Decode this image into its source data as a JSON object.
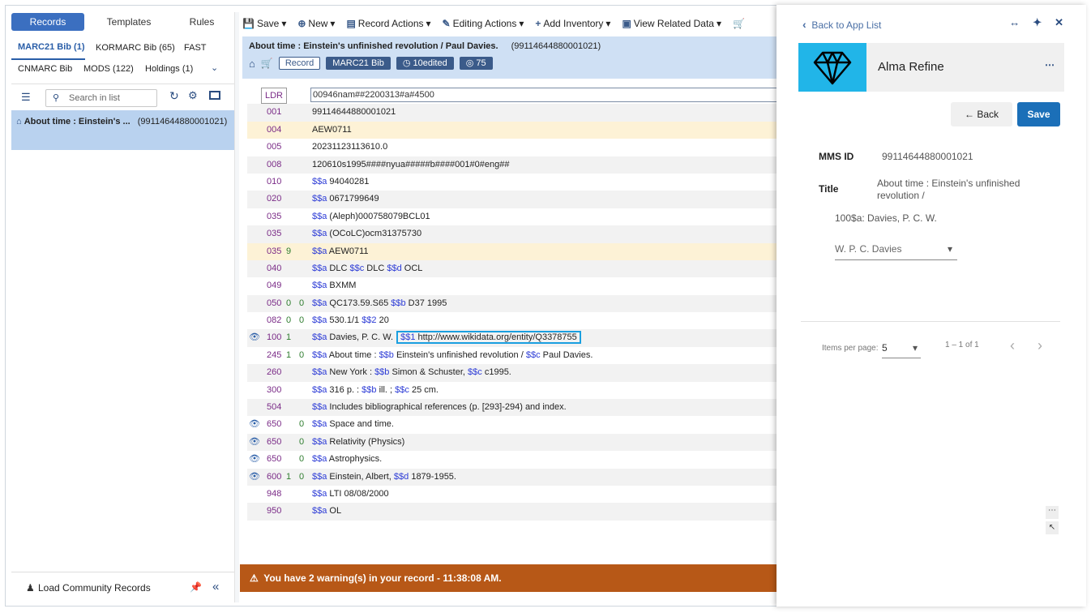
{
  "left": {
    "tabs": [
      "Records",
      "Templates",
      "Rules"
    ],
    "formats_row1": [
      {
        "label": "MARC21 Bib (1)",
        "active": true
      },
      {
        "label": "KORMARC Bib (65)",
        "active": false
      },
      {
        "label": "FAST",
        "active": false
      }
    ],
    "formats_row2": [
      {
        "label": "CNMARC Bib",
        "active": false
      },
      {
        "label": "MODS (122)",
        "active": false
      },
      {
        "label": "Holdings (1)",
        "active": false
      }
    ],
    "search_placeholder": "Search in list",
    "record": {
      "title": "About time : Einstein's ...",
      "id": "(99114644880001021)"
    },
    "load_community": "Load Community Records"
  },
  "toolbar": {
    "save": "Save",
    "new": "New",
    "record_actions": "Record Actions",
    "editing_actions": "Editing Actions",
    "add_inventory": "Add Inventory",
    "view_related": "View Related Data"
  },
  "record_header": {
    "title": "About time : Einstein's unfinished revolution / Paul Davies.",
    "id": "(99114644880001021)",
    "badges": [
      "Record",
      "MARC21 Bib",
      "10edited",
      "75"
    ]
  },
  "marc": {
    "ldr_label": "LDR",
    "ldr_value": "00946nam##2200313#a#4500",
    "fields": [
      {
        "tag": "001",
        "i1": "",
        "i2": "",
        "parts": [
          [
            "t",
            "99114644880001021"
          ]
        ],
        "bg": "alt"
      },
      {
        "tag": "004",
        "i1": "",
        "i2": "",
        "parts": [
          [
            "t",
            "AEW0711"
          ]
        ],
        "bg": "warn"
      },
      {
        "tag": "005",
        "i1": "",
        "i2": "",
        "parts": [
          [
            "t",
            "20231123113610.0"
          ]
        ],
        "bg": ""
      },
      {
        "tag": "008",
        "i1": "",
        "i2": "",
        "parts": [
          [
            "t",
            "120610s1995####nyua#####b####001#0#eng##"
          ]
        ],
        "bg": "alt"
      },
      {
        "tag": "010",
        "i1": "",
        "i2": "",
        "parts": [
          [
            "s",
            "$$a"
          ],
          [
            "t",
            " 94040281"
          ]
        ],
        "bg": ""
      },
      {
        "tag": "020",
        "i1": "",
        "i2": "",
        "parts": [
          [
            "s",
            "$$a"
          ],
          [
            "t",
            " 0671799649"
          ]
        ],
        "bg": "alt"
      },
      {
        "tag": "035",
        "i1": "",
        "i2": "",
        "parts": [
          [
            "s",
            "$$a"
          ],
          [
            "t",
            " (Aleph)000758079BCL01"
          ]
        ],
        "bg": ""
      },
      {
        "tag": "035",
        "i1": "",
        "i2": "",
        "parts": [
          [
            "s",
            "$$a"
          ],
          [
            "t",
            " (OCoLC)ocm31375730"
          ]
        ],
        "bg": "alt"
      },
      {
        "tag": "035",
        "i1": "9",
        "i2": "",
        "parts": [
          [
            "s",
            "$$a"
          ],
          [
            "t",
            " AEW0711"
          ]
        ],
        "bg": "warn"
      },
      {
        "tag": "040",
        "i1": "",
        "i2": "",
        "parts": [
          [
            "s",
            "$$a"
          ],
          [
            "t",
            " DLC "
          ],
          [
            "s",
            "$$c"
          ],
          [
            "t",
            " DLC "
          ],
          [
            "s",
            "$$d"
          ],
          [
            "t",
            " OCL"
          ]
        ],
        "bg": "alt"
      },
      {
        "tag": "049",
        "i1": "",
        "i2": "",
        "parts": [
          [
            "s",
            "$$a"
          ],
          [
            "t",
            " BXMM"
          ]
        ],
        "bg": ""
      },
      {
        "tag": "050",
        "i1": "0",
        "i2": "0",
        "parts": [
          [
            "s",
            "$$a"
          ],
          [
            "t",
            " QC173.59.S65 "
          ],
          [
            "s",
            "$$b"
          ],
          [
            "t",
            " D37 1995"
          ]
        ],
        "bg": "alt"
      },
      {
        "tag": "082",
        "i1": "0",
        "i2": "0",
        "parts": [
          [
            "s",
            "$$a"
          ],
          [
            "t",
            " 530.1/1 "
          ],
          [
            "s",
            "$$2"
          ],
          [
            "t",
            " 20"
          ]
        ],
        "bg": ""
      },
      {
        "tag": "100",
        "i1": "1",
        "i2": "",
        "binoc": true,
        "parts": [
          [
            "s",
            "$$a"
          ],
          [
            "t",
            " Davies, P. C. W."
          ]
        ],
        "hl": [
          [
            "s",
            "$$1"
          ],
          [
            "t",
            " http://www.wikidata.org/entity/Q3378755"
          ]
        ],
        "bg": "alt"
      },
      {
        "tag": "245",
        "i1": "1",
        "i2": "0",
        "parts": [
          [
            "s",
            "$$a"
          ],
          [
            "t",
            " About time : "
          ],
          [
            "s",
            "$$b"
          ],
          [
            "t",
            " Einstein's unfinished revolution / "
          ],
          [
            "s",
            "$$c"
          ],
          [
            "t",
            " Paul Davies."
          ]
        ],
        "bg": ""
      },
      {
        "tag": "260",
        "i1": "",
        "i2": "",
        "parts": [
          [
            "s",
            "$$a"
          ],
          [
            "t",
            " New York : "
          ],
          [
            "s",
            "$$b"
          ],
          [
            "t",
            " Simon & Schuster, "
          ],
          [
            "s",
            "$$c"
          ],
          [
            "t",
            " c1995."
          ]
        ],
        "bg": "alt"
      },
      {
        "tag": "300",
        "i1": "",
        "i2": "",
        "parts": [
          [
            "s",
            "$$a"
          ],
          [
            "t",
            " 316 p. : "
          ],
          [
            "s",
            "$$b"
          ],
          [
            "t",
            " ill. ; "
          ],
          [
            "s",
            "$$c"
          ],
          [
            "t",
            " 25 cm."
          ]
        ],
        "bg": ""
      },
      {
        "tag": "504",
        "i1": "",
        "i2": "",
        "parts": [
          [
            "s",
            "$$a"
          ],
          [
            "t",
            " Includes bibliographical references (p. [293]-294) and index."
          ]
        ],
        "bg": "alt"
      },
      {
        "tag": "650",
        "i1": "",
        "i2": "0",
        "binoc": true,
        "parts": [
          [
            "s",
            "$$a"
          ],
          [
            "t",
            " Space and time."
          ]
        ],
        "bg": ""
      },
      {
        "tag": "650",
        "i1": "",
        "i2": "0",
        "binoc": true,
        "parts": [
          [
            "s",
            "$$a"
          ],
          [
            "t",
            " Relativity (Physics)"
          ]
        ],
        "bg": "alt"
      },
      {
        "tag": "650",
        "i1": "",
        "i2": "0",
        "binoc": true,
        "parts": [
          [
            "s",
            "$$a"
          ],
          [
            "t",
            " Astrophysics."
          ]
        ],
        "bg": ""
      },
      {
        "tag": "600",
        "i1": "1",
        "i2": "0",
        "binoc": true,
        "parts": [
          [
            "s",
            "$$a"
          ],
          [
            "t",
            " Einstein, Albert, "
          ],
          [
            "s",
            "$$d"
          ],
          [
            "t",
            " 1879-1955."
          ]
        ],
        "bg": "alt"
      },
      {
        "tag": "948",
        "i1": "",
        "i2": "",
        "parts": [
          [
            "s",
            "$$a"
          ],
          [
            "t",
            " LTI 08/08/2000"
          ]
        ],
        "bg": ""
      },
      {
        "tag": "950",
        "i1": "",
        "i2": "",
        "parts": [
          [
            "s",
            "$$a"
          ],
          [
            "t",
            " OL"
          ]
        ],
        "bg": "alt"
      }
    ]
  },
  "warning": "You have 2 warning(s) in your record - 11:38:08 AM.",
  "panel": {
    "back_link": "Back to App List",
    "app_name": "Alma Refine",
    "back_btn": "Back",
    "save_btn": "Save",
    "mms_label": "MMS ID",
    "mms_value": "99114644880001021",
    "title_label": "Title",
    "title_value_1": "About time : Einstein's unfinished",
    "title_value_2": "revolution /",
    "field_100": "100$a: Davies, P. C. W.",
    "select_value": "W. P. C. Davies",
    "items_per_page_label": "Items per page:",
    "items_per_page": "5",
    "range": "1 – 1 of 1"
  },
  "colors": {
    "primary": "#3b6fc0",
    "warning_bar": "#b75817",
    "highlight_border": "#1a9fe0",
    "app_logo": "#21b5e8"
  }
}
